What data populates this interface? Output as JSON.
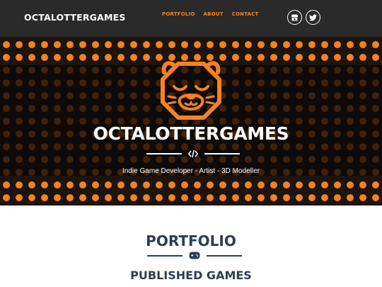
{
  "navbar": {
    "brand": "OCTALOTTERGAMES",
    "links": [
      "PORTFOLIO",
      "ABOUT",
      "CONTACT"
    ],
    "social": [
      {
        "icon": "itchio-icon"
      },
      {
        "icon": "twitter-icon"
      }
    ]
  },
  "masthead": {
    "logo_icon": "octalotter-logo-icon",
    "title": "OCTALOTTERGAMES",
    "divider_icon": "code-icon",
    "subtitle": "Indie Game Developer - Artist - 3D Modeller"
  },
  "portfolio": {
    "title": "PORTFOLIO",
    "divider_icon": "gamepad-icon",
    "subtitle": "PUBLISHED GAMES"
  },
  "colors": {
    "accent": "#f58220",
    "navbar_bg": "#2a2a2a",
    "heading": "#2c3e50"
  }
}
